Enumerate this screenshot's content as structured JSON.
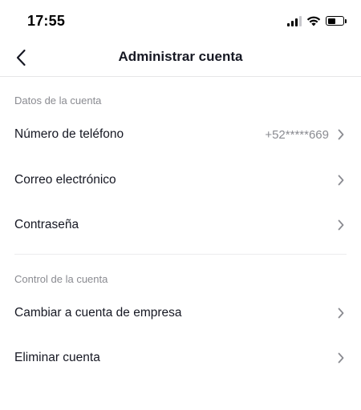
{
  "status_bar": {
    "time": "17:55",
    "icons": [
      "signal-icon",
      "wifi-icon",
      "battery-icon"
    ],
    "battery_level": 0.5
  },
  "header": {
    "title": "Administrar cuenta",
    "back_icon": "chevron-left-icon"
  },
  "sections": [
    {
      "title": "Datos de la cuenta",
      "items": [
        {
          "label": "Número de teléfono",
          "value": "+52*****669"
        },
        {
          "label": "Correo electrónico"
        },
        {
          "label": "Contraseña"
        }
      ]
    },
    {
      "title": "Control de la cuenta",
      "items": [
        {
          "label": "Cambiar a cuenta de empresa"
        },
        {
          "label": "Eliminar cuenta"
        }
      ]
    }
  ],
  "colors": {
    "text_primary": "#161823",
    "text_secondary": "#8a8b91",
    "divider": "#ececee",
    "background": "#ffffff"
  }
}
